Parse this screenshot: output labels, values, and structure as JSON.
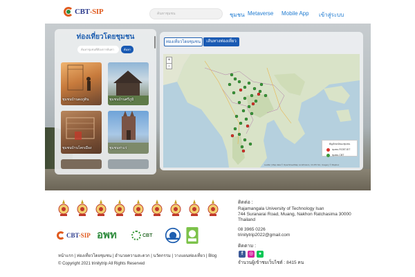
{
  "header": {
    "logo_text_1": "CBT",
    "logo_text_2": "-SIP",
    "search_placeholder": "ค้นหาชุมชน",
    "nav": [
      "ชุมชน",
      "Metaverse",
      "Mobile App",
      "เข้าสู่ระบบ"
    ]
  },
  "left_panel": {
    "title": "ท่องเที่ยวโดยชุมชน",
    "search_placeholder": "ค้นหาชุมชนที่ต้องการค้นหา",
    "search_button": "ค้นหา",
    "tiles": [
      {
        "caption": "ชุมชนบ้านดงภูดิน"
      },
      {
        "caption": "ชุมชนบ้านศรีภูมิ"
      },
      {
        "caption": "ชุมชนบ้านโคกเมือง"
      },
      {
        "caption": "ชุมชนท่าแร่"
      },
      {
        "caption": ""
      },
      {
        "caption": ""
      }
    ]
  },
  "map_panel": {
    "tabs": [
      "ท่องเที่ยวโดยชุมชน",
      "เส้นทางท่องเที่ยว"
    ],
    "active_tab": 1,
    "zoom_in": "+",
    "zoom_out": "−",
    "legend_title": "สัญลักษณ์ของชุมชน",
    "legend_items": [
      {
        "label": "ชุมชน RCBT-SIT",
        "color": "#d9342b"
      },
      {
        "label": "ชุมชน CBT",
        "color": "#3a9a3a"
      }
    ],
    "attribution": "Leaflet | Map data © OpenStreetMap contributors, CC-BY-SA, Imagery © Mapbox"
  },
  "footer": {
    "links": "หน้าแรก | ท่องเที่ยวโดยชุมชน | อำนวยความสะดวก | นวัตกรรม | วางแผนท่องเที่ยว | Blog",
    "copyright": "© Copyright 2021 trinitytrip  All Rights Reserved",
    "partner_oth": "อพท",
    "partner_cbt": "CBT",
    "contact_heading": "ติดต่อ :",
    "address_1": "Rajamangala University of Technology Isan",
    "address_2": "744 Suranarai Road, Muang, Nakhon Ratchasima 30000",
    "address_3": "Thailand",
    "phone": "08 3965 0226",
    "email": "trinitytrip2022@gmail.com",
    "follow_heading": "ติดตาม :",
    "visitors": "จำนวนผู้เข้าชมเว็บไซต์ : 8415 คน"
  }
}
